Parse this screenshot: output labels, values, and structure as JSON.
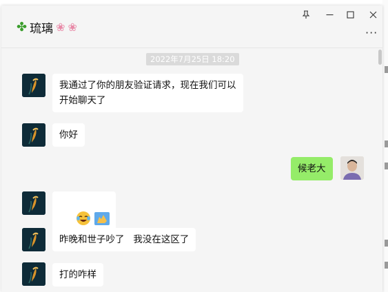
{
  "window": {
    "contact_name": "琉璃",
    "icons": {
      "clover": "four-leaf-clover-icon",
      "flower": "cherry-blossom-icon"
    }
  },
  "controls": {
    "pin_label": "⚲",
    "minimize_label": "—",
    "maximize_label": "☐",
    "close_label": "✕",
    "more_label": "···"
  },
  "chat": {
    "timestamp": "2022年7月25日 18:20",
    "messages": [
      {
        "side": "left",
        "text": "我通过了你的朋友验证请求，现在我们可以\n开始聊天了"
      },
      {
        "side": "left",
        "text": "你好"
      },
      {
        "side": "right",
        "text": "候老大"
      },
      {
        "side": "left",
        "type": "emoji",
        "emojis": [
          "laughing-crying-face-icon",
          "thumbs-up-hand-icon"
        ]
      },
      {
        "side": "left",
        "text": "昨晚和世子吵了   我没在这区了"
      },
      {
        "side": "left",
        "text": "打的咋样"
      }
    ]
  },
  "colors": {
    "outgoing_bubble": "#95ec69",
    "incoming_bubble": "#ffffff",
    "chat_background": "#f5f5f5"
  }
}
